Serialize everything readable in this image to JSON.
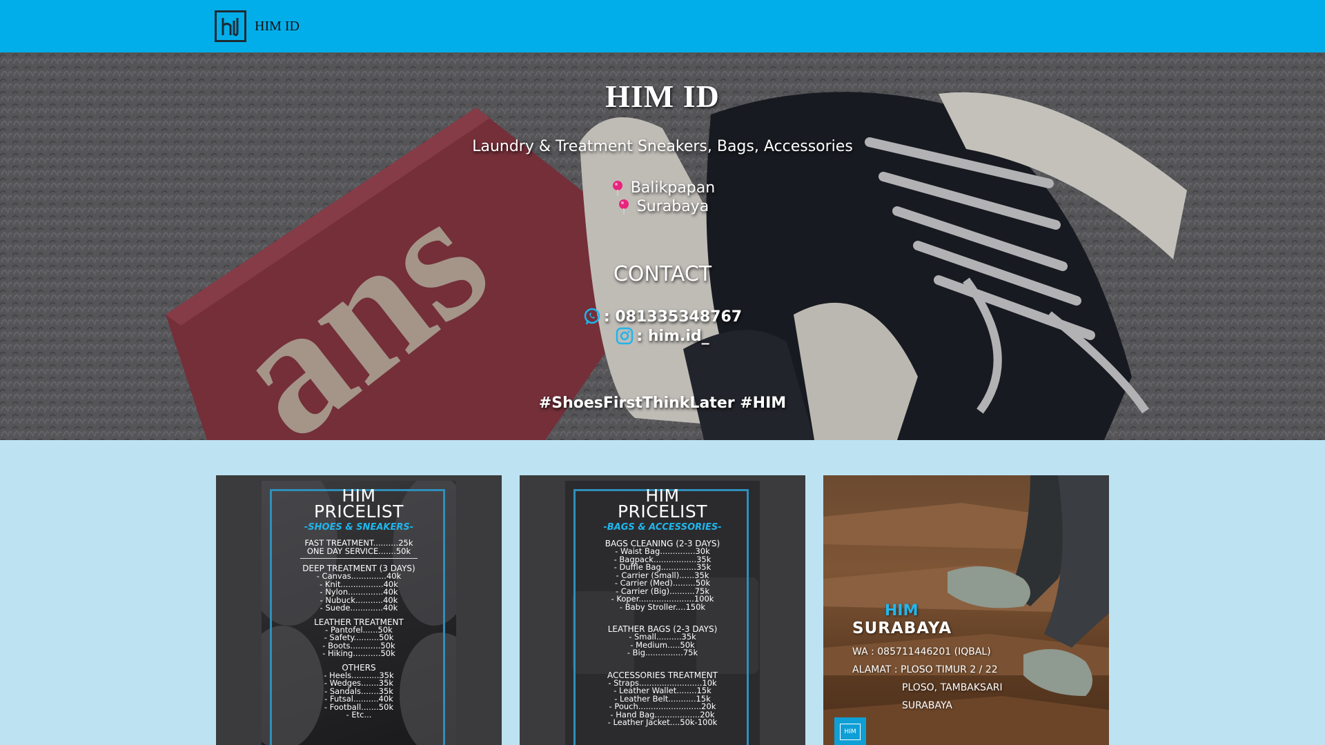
{
  "navbar": {
    "brand": "HIM ID",
    "bg_color": "#02aeea"
  },
  "hero": {
    "title": "HIM ID",
    "subtitle": "Laundry & Treatment Sneakers, Bags, Accessories",
    "locations": [
      "Balikpapan",
      "Surabaya"
    ],
    "contact_title": "CONTACT",
    "contacts": [
      {
        "icon": "whatsapp-icon",
        "text": ": 081335348767"
      },
      {
        "icon": "instagram-icon",
        "text": ": him.id_"
      }
    ],
    "hashtag": "#ShoesFirstThinkLater #HIM"
  },
  "cards": {
    "shoes": {
      "head1": "HIM",
      "head2": "PRICELIST",
      "sub": "-SHOES & SNEAKERS-",
      "lines_top": [
        "FAST TREATMENT..........25k",
        "ONE DAY SERVICE.......50k"
      ],
      "deep_title": "DEEP TREATMENT (3 DAYS)",
      "deep": [
        "- Canvas..............40k",
        "- Knit.................40k",
        "- Nylon..............40k",
        "- Nubuck...........40k",
        "- Suede.............40k"
      ],
      "leather_title": "LEATHER TREATMENT",
      "leather": [
        "- Pantofel......50k",
        "- Safety..........50k",
        "- Boots............50k",
        "- Hiking...........50k"
      ],
      "others_title": "OTHERS",
      "others": [
        "- Heels...........35k",
        "- Wedges.......35k",
        "- Sandals.......35k",
        "- Futsal..........40k",
        "- Football.......50k",
        "- Etc..."
      ]
    },
    "bags": {
      "head1": "HIM",
      "head2": "PRICELIST",
      "sub": "-BAGS & ACCESSORIES-",
      "cleaning_title": "BAGS CLEANING (2-3 DAYS)",
      "cleaning": [
        "- Waist Bag..............30k",
        "- Bagpack.................35k",
        "- Duffle Bag..............35k",
        "- Carrier (Small)......35k",
        "- Carrier (Med).........50k",
        "- Carrier (Big)..........75k",
        "- Koper......................100k",
        "- Baby Stroller....150k"
      ],
      "leather_title": "LEATHER BAGS (2-3 DAYS)",
      "leather": [
        "- Small..........35k",
        "- Medium.....50k",
        "- Big...............75k"
      ],
      "acc_title": "ACCESSORIES TREATMENT",
      "acc": [
        "- Straps.........................10k",
        "- Leather Wallet........15k",
        "- Leather Belt...........15k",
        "- Pouch.........................20k",
        "- Hand Bag..................20k",
        "- Leather Jacket....50k-100k"
      ]
    },
    "surabaya": {
      "him": "HIM",
      "city": "SURABAYA",
      "wa": "WA : 085711446201 (IQBAL)",
      "alamat": "ALAMAT : PLOSO TIMUR 2 / 22",
      "alamat2": "PLOSO, TAMBAKSARI",
      "alamat3": "SURABAYA",
      "logo_text": "HIM"
    }
  }
}
